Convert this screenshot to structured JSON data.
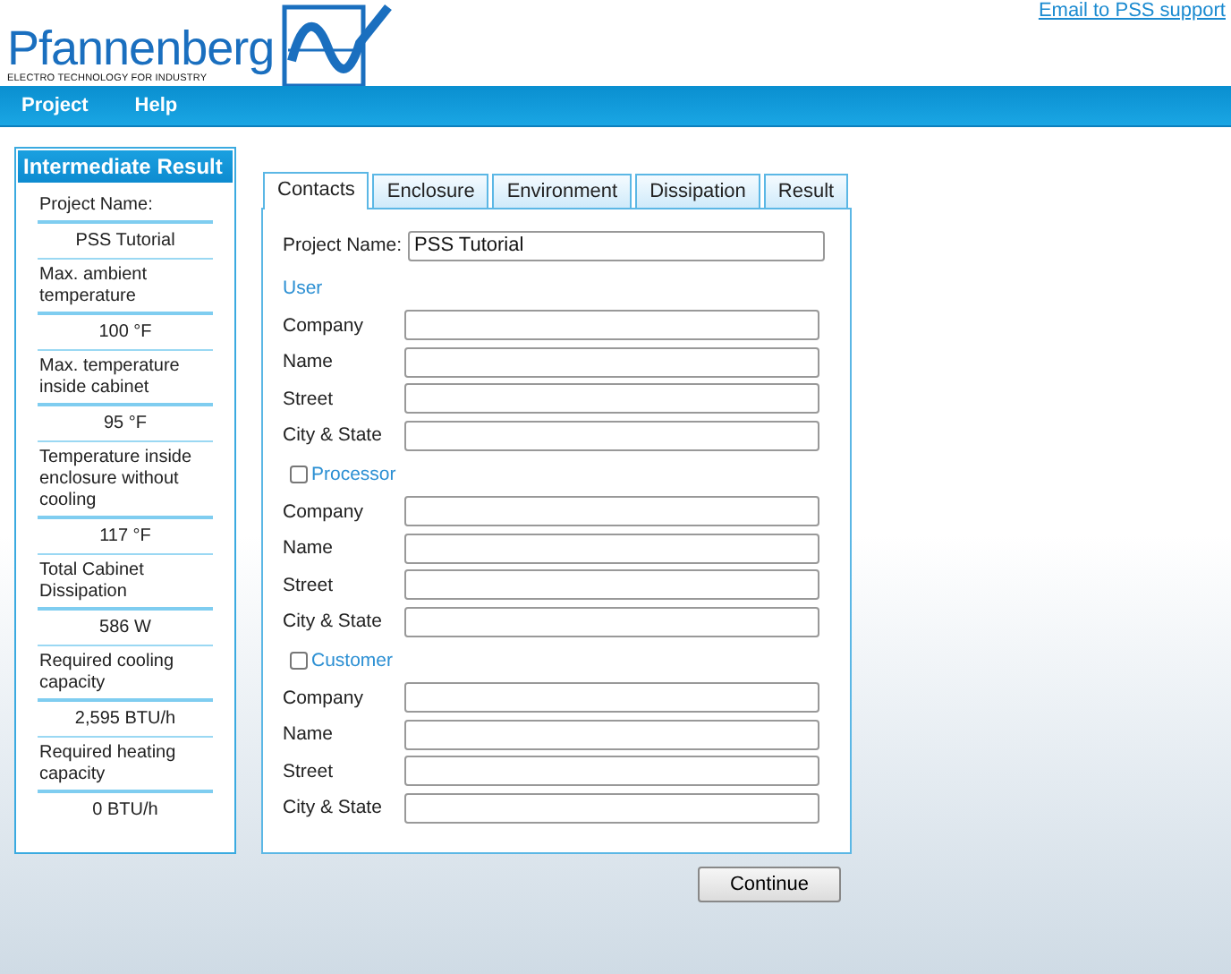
{
  "header": {
    "logo_name": "Pfannenberg",
    "logo_tagline": "ELECTRO TECHNOLOGY FOR INDUSTRY",
    "support_link": "Email to PSS support"
  },
  "menu": [
    "Project",
    "Help"
  ],
  "sidebar": {
    "title": "Intermediate Result",
    "items": [
      {
        "label": "Project Name:",
        "value": "PSS Tutorial"
      },
      {
        "label": "Max. ambient temperature",
        "value": "100 °F"
      },
      {
        "label": "Max. temperature inside cabinet",
        "value": "95 °F"
      },
      {
        "label": "Temperature inside enclosure without cooling",
        "value": "117 °F"
      },
      {
        "label": "Total Cabinet Dissipation",
        "value": "586 W"
      },
      {
        "label": "Required cooling capacity",
        "value": "2,595 BTU/h"
      },
      {
        "label": "Required heating capacity",
        "value": "0 BTU/h"
      }
    ]
  },
  "tabs": [
    {
      "label": "Contacts",
      "selected": true
    },
    {
      "label": "Enclosure",
      "selected": false
    },
    {
      "label": "Environment",
      "selected": false
    },
    {
      "label": "Dissipation",
      "selected": false
    },
    {
      "label": "Result",
      "selected": false
    }
  ],
  "form": {
    "project_name": {
      "label": "Project Name:",
      "value": "PSS Tutorial"
    },
    "sections": [
      {
        "kind": "heading",
        "title": "User",
        "fields": [
          "Company",
          "Name",
          "Street",
          "City & State"
        ]
      },
      {
        "kind": "checkbox",
        "title": "Processor",
        "checked": false,
        "fields": [
          "Company",
          "Name",
          "Street",
          "City & State"
        ]
      },
      {
        "kind": "checkbox",
        "title": "Customer",
        "checked": false,
        "fields": [
          "Company",
          "Name",
          "Street",
          "City & State"
        ]
      }
    ]
  },
  "continue_button": "Continue"
}
